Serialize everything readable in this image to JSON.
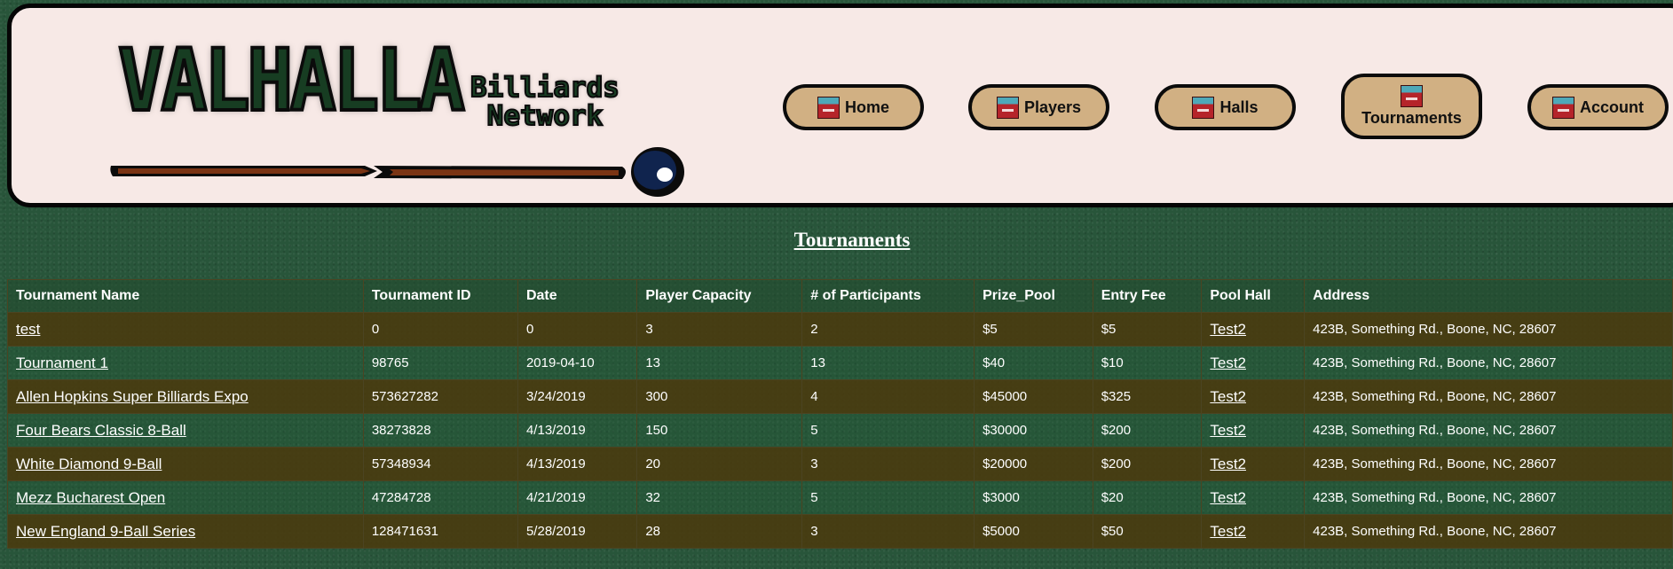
{
  "brand": {
    "logo_main": "VALHALLA",
    "logo_sub_1": "Billiards",
    "logo_sub_2": "Network"
  },
  "nav": [
    {
      "label": "Home",
      "icon": "chalk-icon"
    },
    {
      "label": "Players",
      "icon": "chalk-icon"
    },
    {
      "label": "Halls",
      "icon": "chalk-icon"
    },
    {
      "label": "Tournaments",
      "icon": "chalk-icon",
      "active": true
    },
    {
      "label": "Account",
      "icon": "chalk-icon"
    }
  ],
  "page_title": "Tournaments",
  "table": {
    "headers": [
      "Tournament Name",
      "Tournament ID",
      "Date",
      "Player Capacity",
      "# of Participants",
      "Prize_Pool",
      "Entry Fee",
      "Pool Hall",
      "Address"
    ],
    "rows": [
      {
        "name": "test",
        "id": "0",
        "date": "0",
        "capacity": "3",
        "participants": "2",
        "prize": "$5",
        "fee": "$5",
        "hall": "Test2",
        "address": "423B, Something Rd., Boone, NC, 28607"
      },
      {
        "name": "Tournament 1",
        "id": "98765",
        "date": "2019-04-10",
        "capacity": "13",
        "participants": "13",
        "prize": "$40",
        "fee": "$10",
        "hall": "Test2",
        "address": "423B, Something Rd., Boone, NC, 28607"
      },
      {
        "name": "Allen Hopkins Super Billiards Expo",
        "id": "573627282",
        "date": "3/24/2019",
        "capacity": "300",
        "participants": "4",
        "prize": "$45000",
        "fee": "$325",
        "hall": "Test2",
        "address": "423B, Something Rd., Boone, NC, 28607"
      },
      {
        "name": "Four Bears Classic 8-Ball",
        "id": "38273828",
        "date": "4/13/2019",
        "capacity": "150",
        "participants": "5",
        "prize": "$30000",
        "fee": "$200",
        "hall": "Test2",
        "address": "423B, Something Rd., Boone, NC, 28607"
      },
      {
        "name": "White Diamond 9-Ball",
        "id": "57348934",
        "date": "4/13/2019",
        "capacity": "20",
        "participants": "3",
        "prize": "$20000",
        "fee": "$200",
        "hall": "Test2",
        "address": "423B, Something Rd., Boone, NC, 28607"
      },
      {
        "name": "Mezz Bucharest Open",
        "id": "47284728",
        "date": "4/21/2019",
        "capacity": "32",
        "participants": "5",
        "prize": "$3000",
        "fee": "$20",
        "hall": "Test2",
        "address": "423B, Something Rd., Boone, NC, 28607"
      },
      {
        "name": "New England 9-Ball Series",
        "id": "128471631",
        "date": "5/28/2019",
        "capacity": "28",
        "participants": "3",
        "prize": "$5000",
        "fee": "$50",
        "hall": "Test2",
        "address": "423B, Something Rd., Boone, NC, 28607"
      }
    ]
  },
  "colors": {
    "felt": "#28553a",
    "header_bg": "#f7e9e6",
    "button": "#d1b083",
    "logo": "#173d22",
    "row_dark": "#4a3a0e"
  }
}
